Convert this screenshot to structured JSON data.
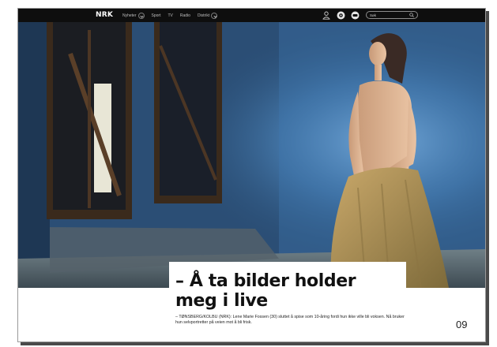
{
  "navbar": {
    "logo": "NRK",
    "items": [
      {
        "label": "Nyheter",
        "has_dropdown": true
      },
      {
        "label": "Sport",
        "has_dropdown": false
      },
      {
        "label": "TV",
        "has_dropdown": false
      },
      {
        "label": "Radio",
        "has_dropdown": false
      },
      {
        "label": "Distrikt",
        "has_dropdown": true
      }
    ],
    "search_placeholder": "Søk",
    "icons": [
      "user-icon",
      "nrk-super-icon",
      "nrk-p3-icon",
      "search-icon"
    ]
  },
  "article": {
    "headline": "– Å ta bilder holder meg i live",
    "lede": "– TØNSBERG/KOLBU (NRK): Lene Marie Fossen (30) sluttet å spise som 10-åring fordi hun ikke ville bli voksen. Nå bruker hun selvportretter på veien mot å bli frisk."
  },
  "page_number": "09",
  "colors": {
    "navbar": "#0e0e0e",
    "hero_blue": "#2f587f",
    "headline": "#111111"
  }
}
